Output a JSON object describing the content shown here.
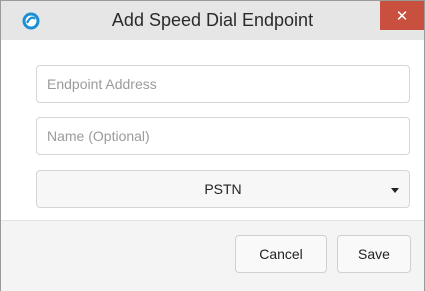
{
  "dialog": {
    "title": "Add Speed Dial Endpoint",
    "close_glyph": "✕",
    "app_icon": "app-logo-icon"
  },
  "form": {
    "endpoint_address": {
      "value": "",
      "placeholder": "Endpoint Address"
    },
    "name": {
      "value": "",
      "placeholder": "Name (Optional)"
    },
    "type_select": {
      "selected": "PSTN"
    }
  },
  "footer": {
    "cancel_label": "Cancel",
    "save_label": "Save"
  },
  "colors": {
    "titlebar": "#e6e6e6",
    "close_button": "#c9503f",
    "footer": "#f4f4f4"
  }
}
